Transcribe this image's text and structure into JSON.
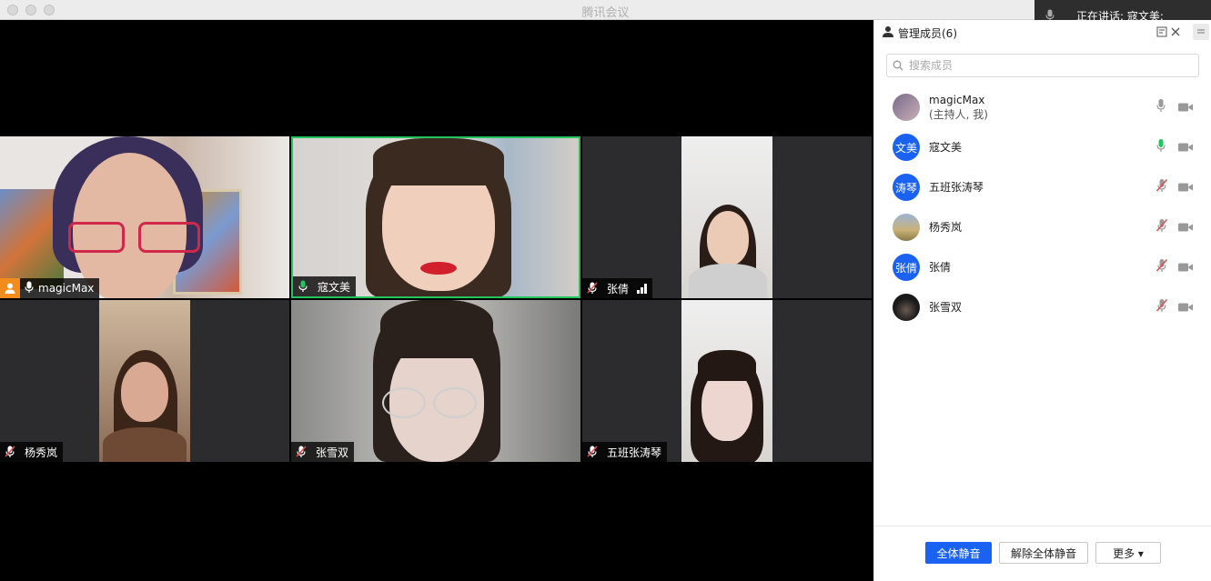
{
  "window": {
    "title": "腾讯会议"
  },
  "speaking_toast": {
    "text": "正在讲话: 寇文美;"
  },
  "tiles": [
    {
      "name": "magicMax",
      "host": true,
      "mic": "on"
    },
    {
      "name": "寇文美",
      "speaking": true,
      "mic": "active"
    },
    {
      "name": "张倩",
      "mic": "muted",
      "signal": true
    },
    {
      "name": "杨秀岚",
      "mic": "muted"
    },
    {
      "name": "张雪双",
      "mic": "muted"
    },
    {
      "name": "五班张涛琴",
      "mic": "muted"
    }
  ],
  "panel": {
    "title": "管理成员(6)",
    "search_placeholder": "搜索成员",
    "members": [
      {
        "name": "magicMax",
        "sub": "(主持人, 我)",
        "avatar_text": "",
        "mic": "on"
      },
      {
        "name": "寇文美",
        "avatar_text": "文美",
        "mic": "active"
      },
      {
        "name": "五班张涛琴",
        "avatar_text": "涛琴",
        "mic": "muted"
      },
      {
        "name": "杨秀岚",
        "avatar_text": "",
        "mic": "muted"
      },
      {
        "name": "张倩",
        "avatar_text": "张倩",
        "mic": "muted"
      },
      {
        "name": "张雪双",
        "avatar_text": "",
        "mic": "muted"
      }
    ],
    "buttons": {
      "mute_all": "全体静音",
      "unmute_all": "解除全体静音",
      "more": "更多 ▾"
    }
  },
  "colors": {
    "accent": "#1a62f2",
    "speaking": "#22c55e",
    "muted": "#e05050",
    "host": "#f28c1c"
  }
}
